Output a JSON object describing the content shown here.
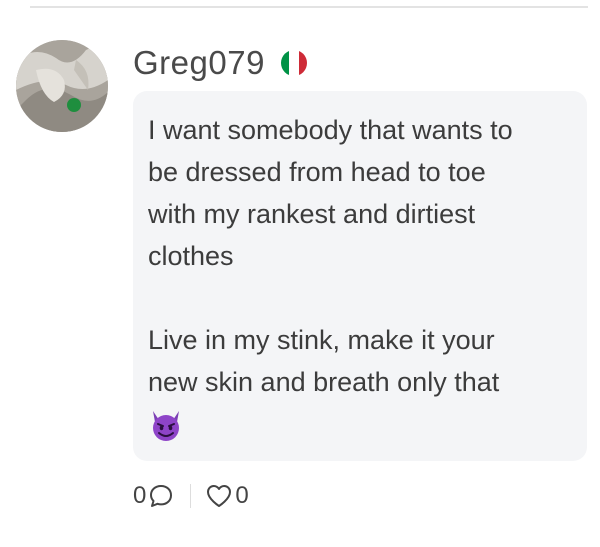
{
  "comment": {
    "author": {
      "username": "Greg079",
      "flag_icon": "italy-flag-icon",
      "flag_colors": [
        "#009246",
        "#ffffff",
        "#ce2b37"
      ],
      "online_status_color": "#1e8e3e"
    },
    "message_lines": [
      "I want somebody that wants to",
      "be dressed from head to toe",
      "with my rankest and dirtiest",
      "clothes",
      "",
      "Live in my stink, make it your",
      "new skin and breath only that"
    ],
    "message_emoji": "smiling-devil-emoji",
    "actions": {
      "comment_count": "0",
      "comment_icon": "comment-bubble-icon",
      "like_count": "0",
      "like_icon": "heart-icon"
    }
  }
}
